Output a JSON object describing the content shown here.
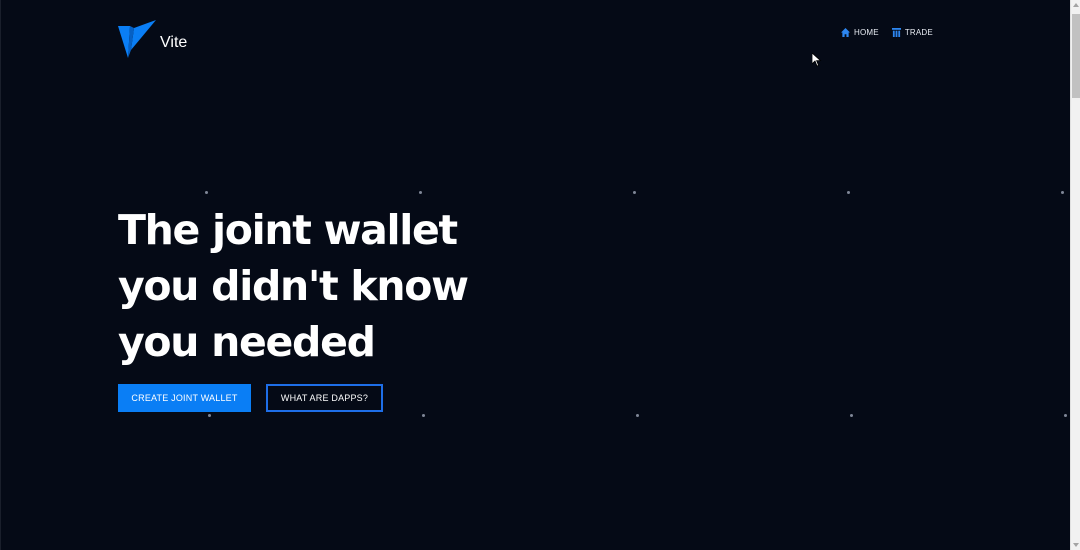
{
  "brand": {
    "name": "Vite",
    "logo_icon": "vite-logo-icon",
    "accent": "#0a7ef5"
  },
  "nav": {
    "items": [
      {
        "label": "HOME",
        "icon": "home-icon"
      },
      {
        "label": "TRADE",
        "icon": "trade-icon"
      }
    ]
  },
  "hero": {
    "title_lines": [
      "The joint wallet",
      "you didn't know",
      "you needed"
    ],
    "primary_button": "CREATE JOINT WALLET",
    "secondary_button": "WHAT ARE DAPPS?"
  },
  "colors": {
    "background": "#050a16",
    "button_primary": "#0a7ef5",
    "button_outline_border": "#1e6ee8"
  }
}
